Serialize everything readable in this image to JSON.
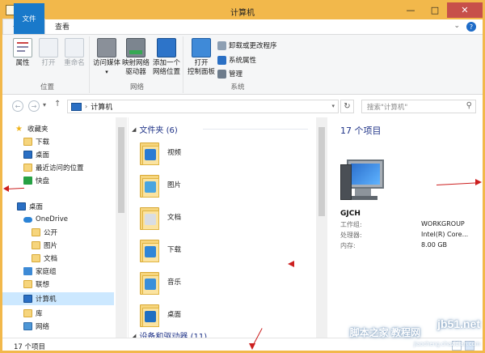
{
  "window": {
    "title": "计算机"
  },
  "ribbon": {
    "tabs": [
      {
        "label": "文件"
      },
      {
        "label": "计算机"
      },
      {
        "label": "查看"
      }
    ],
    "groups": {
      "location": {
        "label": "位置",
        "buttons": [
          {
            "label": "属性"
          },
          {
            "label": "打开"
          },
          {
            "label": "重命名"
          }
        ]
      },
      "network": {
        "label": "网络",
        "buttons": [
          {
            "label": "访问媒体"
          },
          {
            "label": "映射网络\n驱动器"
          },
          {
            "label": "添加一个\n网络位置"
          }
        ]
      },
      "system": {
        "label": "系统",
        "big": {
          "label": "打开\n控制面板"
        },
        "small": [
          {
            "label": "卸载或更改程序"
          },
          {
            "label": "系统属性"
          },
          {
            "label": "管理"
          }
        ]
      }
    }
  },
  "address": {
    "crumb": "计算机",
    "search_placeholder": "搜索\"计算机\""
  },
  "navpane": {
    "items": [
      {
        "label": "收藏夹"
      },
      {
        "label": "下载"
      },
      {
        "label": "桌面"
      },
      {
        "label": "最近访问的位置"
      },
      {
        "label": "快盘"
      },
      {
        "label": "桌面"
      },
      {
        "label": "OneDrive"
      },
      {
        "label": "公开"
      },
      {
        "label": "图片"
      },
      {
        "label": "文档"
      },
      {
        "label": "家庭组"
      },
      {
        "label": "联想"
      },
      {
        "label": "计算机"
      },
      {
        "label": "库"
      },
      {
        "label": "网络"
      }
    ]
  },
  "content": {
    "folders_header": "文件夹 (6)",
    "folders": [
      {
        "label": "视频",
        "color": "#2a7bd4"
      },
      {
        "label": "图片",
        "color": "#4aa5e0"
      },
      {
        "label": "文档",
        "color": "#d9dde3"
      },
      {
        "label": "下载",
        "color": "#2f86d8"
      },
      {
        "label": "音乐",
        "color": "#3a8fda"
      },
      {
        "label": "桌面",
        "color": "#1f6fc2"
      }
    ],
    "devices_header": "设备和驱动器 (11)"
  },
  "details": {
    "count": "17 个项目",
    "name": "GJCH",
    "rows": [
      {
        "label": "工作组:",
        "value": "WORKGROUP"
      },
      {
        "label": "处理器:",
        "value": "Intel(R) Core..."
      },
      {
        "label": "内存:",
        "value": "8.00 GB"
      }
    ]
  },
  "status": {
    "text": "17 个项目"
  },
  "watermark": {
    "main": "jb51.net",
    "sub": "脚本之家 教程网",
    "url": "jiaocheng.chazidian.com"
  },
  "colors": {
    "accent": "#f2b84b",
    "file_tab": "#1979ca",
    "header_text": "#1e3287",
    "arrow": "#cc1f1f"
  }
}
